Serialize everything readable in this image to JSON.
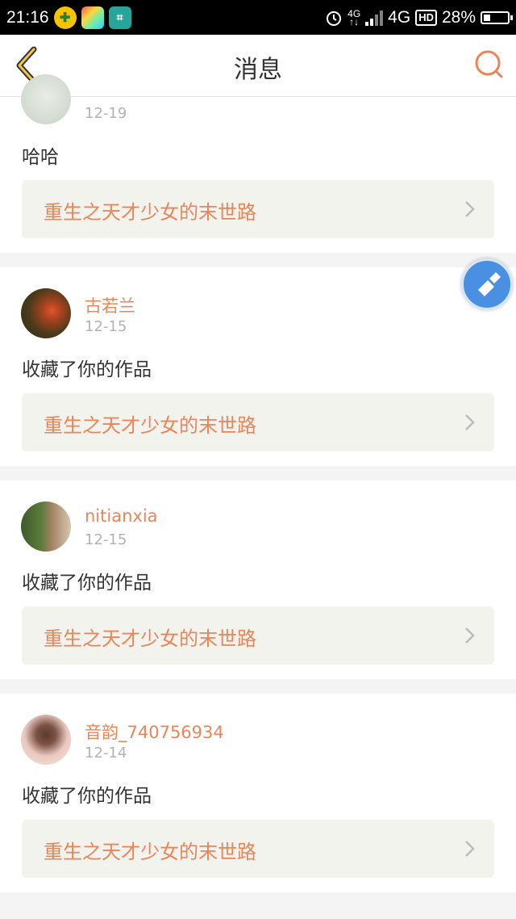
{
  "status_bar": {
    "time": "21:16",
    "net_small_top": "4G",
    "net_small_bottom": "↑↓",
    "network": "4G",
    "hd": "HD",
    "battery": "28%",
    "battery_level": 0.28,
    "apps": [
      "plus-app-icon",
      "colorful-app-icon",
      "scan-app-icon"
    ]
  },
  "header": {
    "title": "消息",
    "back_icon": "chevron-left-icon",
    "search_icon": "search-icon",
    "accent": "#e8865a"
  },
  "messages": [
    {
      "user": "",
      "date": "12-19",
      "text": "哈哈",
      "work": "重生之天才少女的末世路"
    },
    {
      "user": "古若兰",
      "date": "12-15",
      "text": "收藏了你的作品",
      "work": "重生之天才少女的末世路"
    },
    {
      "user": "nitianxia",
      "date": "12-15",
      "text": "收藏了你的作品",
      "work": "重生之天才少女的末世路"
    },
    {
      "user": "音韵_740756934",
      "date": "12-14",
      "text": "收藏了你的作品",
      "work": "重生之天才少女的末世路"
    }
  ],
  "floating_button": {
    "icon": "broom-icon"
  }
}
